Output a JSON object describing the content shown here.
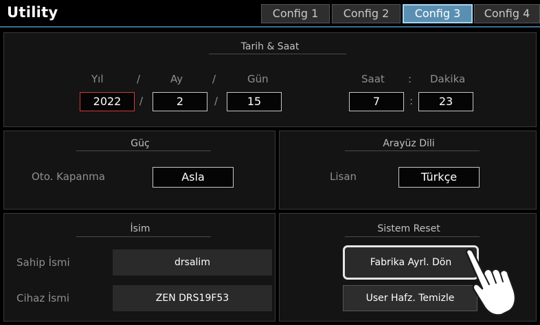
{
  "app": {
    "title": "Utility"
  },
  "tabs": [
    {
      "label": "Config 1",
      "active": false
    },
    {
      "label": "Config 2",
      "active": false
    },
    {
      "label": "Config 3",
      "active": true
    },
    {
      "label": "Config 4",
      "active": false
    }
  ],
  "datetime": {
    "title": "Tarih & Saat",
    "year_label": "Yıl",
    "month_label": "Ay",
    "day_label": "Gün",
    "hour_label": "Saat",
    "minute_label": "Dakika",
    "date_separator": "/",
    "time_separator": ":",
    "year": "2022",
    "month": "2",
    "day": "15",
    "hour": "7",
    "minute": "23"
  },
  "power": {
    "title": "Güç",
    "auto_off_label": "Oto. Kapanma",
    "auto_off_value": "Asla"
  },
  "language": {
    "title": "Arayüz Dili",
    "lang_label": "Lisan",
    "lang_value": "Türkçe"
  },
  "name": {
    "title": "İsim",
    "owner_label": "Sahip İsmi",
    "owner_value": "drsalim",
    "device_label": "Cihaz İsmi",
    "device_value": "ZEN DRS19F53"
  },
  "reset": {
    "title": "Sistem Reset",
    "factory_button": "Fabrika Ayrl. Dön",
    "user_button": "User Hafz. Temizle"
  },
  "colors": {
    "accent": "#5b8fb2",
    "active_tab_border": "#a5d5ee",
    "selected_field_border": "#d23a3a"
  }
}
